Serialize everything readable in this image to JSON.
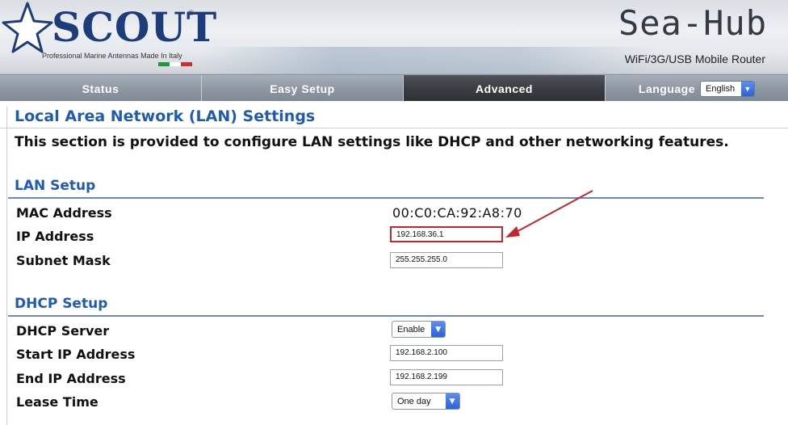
{
  "header": {
    "logo_text": "SCOUT",
    "logo_registered": "®",
    "logo_tagline": "Professional Marine Antennas Made In Italy",
    "product_title": "Sea-Hub",
    "product_subtitle": "WiFi/3G/USB Mobile Router",
    "flag_colors": [
      "#1a9a3a",
      "#ffffff",
      "#d42a2a"
    ]
  },
  "nav": {
    "tabs": [
      {
        "label": "Status",
        "active": false
      },
      {
        "label": "Easy Setup",
        "active": false
      },
      {
        "label": "Advanced",
        "active": true
      }
    ],
    "language_label": "Language",
    "language_value": "English"
  },
  "page": {
    "title": "Local Area Network (LAN) Settings",
    "description": "This section is provided to configure LAN settings like DHCP and other networking features."
  },
  "lan_setup": {
    "title": "LAN Setup",
    "mac_label": "MAC Address",
    "mac_value": "00:C0:CA:92:A8:70",
    "ip_label": "IP Address",
    "ip_value": "192.168.36.1",
    "subnet_label": "Subnet Mask",
    "subnet_value": "255.255.255.0"
  },
  "dhcp_setup": {
    "title": "DHCP Setup",
    "server_label": "DHCP Server",
    "server_value": "Enable",
    "start_label": "Start IP Address",
    "start_value": "192.168.2.100",
    "end_label": "End IP Address",
    "end_value": "192.168.2.199",
    "lease_label": "Lease Time",
    "lease_value": "One day"
  },
  "colors": {
    "accent_blue": "#1f5bb5",
    "highlight_red": "#c4262e",
    "active_tab": "#3a3d42"
  },
  "icons": {
    "logo": "star-icon",
    "dropdown": "chevron-down-icon",
    "annotation": "arrow-icon"
  }
}
